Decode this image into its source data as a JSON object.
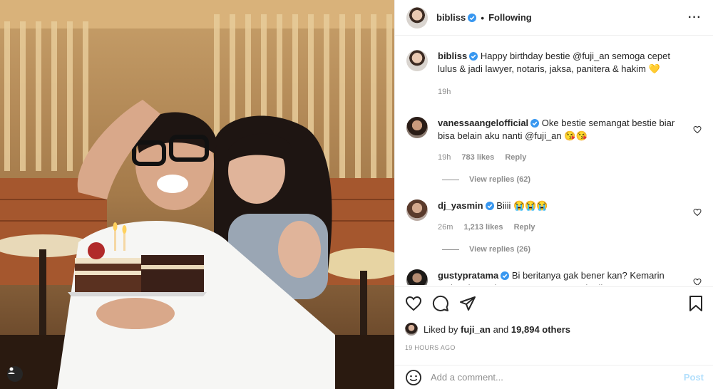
{
  "header": {
    "username": "bibliss",
    "follow_status": "Following",
    "more_icon": "ellipsis-icon"
  },
  "caption": {
    "username": "bibliss",
    "text": "Happy birthday bestie @fuji_an semoga cepet lulus & jadi lawyer, notaris, jaksa, panitera & hakim 💛",
    "time": "19h"
  },
  "comments": [
    {
      "username": "vanessaangelofficial",
      "text": "Oke bestie semangat bestie biar bisa belain aku nanti @fuji_an 😘😘",
      "time": "19h",
      "likes": "783 likes",
      "reply": "Reply",
      "view_replies": "View replies (62)"
    },
    {
      "username": "dj_yasmin",
      "text": "Biiii 😭😭😭",
      "time": "26m",
      "likes": "1,213 likes",
      "reply": "Reply",
      "view_replies": "View replies (26)"
    },
    {
      "username": "gustypratama",
      "text": "Bi beritanya gak bener kan? Kemarin malem baru aja gue papasan sama lo di PS..",
      "time": "",
      "likes": "",
      "reply": ""
    }
  ],
  "likes": {
    "prefix": "Liked by",
    "user": "fuji_an",
    "middle": "and",
    "others": "19,894 others"
  },
  "timestamp": "19 HOURS AGO",
  "add_comment": {
    "placeholder": "Add a comment...",
    "post_label": "Post"
  },
  "colors": {
    "verified": "#3897f0",
    "muted": "#8e8e8e",
    "post_disabled": "#b2dffc"
  }
}
